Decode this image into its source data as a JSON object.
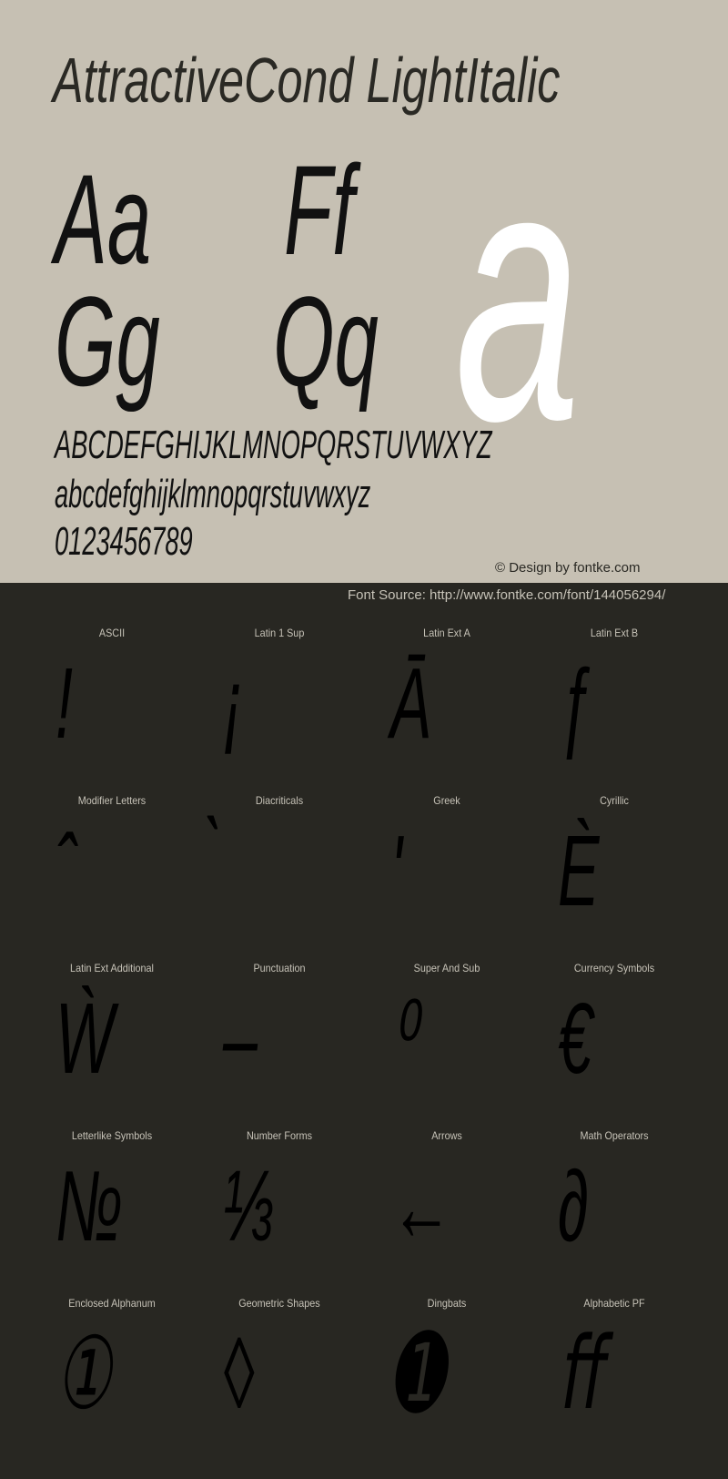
{
  "specimen": {
    "title": "AttractiveCond LightItalic",
    "pairs": [
      "Aa",
      "Ff",
      "Gg",
      "Qq"
    ],
    "hero_glyph": "a",
    "uppercase": "ABCDEFGHIJKLMNOPQRSTUVWXYZ",
    "lowercase": "abcdefghijklmnopqrstuvwxyz",
    "digits": "0123456789",
    "credit": "© Design by fontke.com",
    "source": "Font Source: http://www.fontke.com/font/144056294/"
  },
  "colors": {
    "top_background": "#c6c0b3",
    "bottom_background": "#282722",
    "hero_glyph": "#ffffff",
    "label_text": "#c7c3b8"
  },
  "blocks": [
    {
      "label": "ASCII",
      "glyph": "!"
    },
    {
      "label": "Latin 1 Sup",
      "glyph": "¡"
    },
    {
      "label": "Latin Ext A",
      "glyph": "Ā"
    },
    {
      "label": "Latin Ext B",
      "glyph": "ƒ"
    },
    {
      "label": "Modifier Letters",
      "glyph": "ˆ"
    },
    {
      "label": "Diacriticals",
      "glyph": "̀"
    },
    {
      "label": "Greek",
      "glyph": "ʹ"
    },
    {
      "label": "Cyrillic",
      "glyph": "Ѐ"
    },
    {
      "label": "Latin Ext Additional",
      "glyph": "Ẁ"
    },
    {
      "label": "Punctuation",
      "glyph": "–"
    },
    {
      "label": "Super And Sub",
      "glyph": "⁰"
    },
    {
      "label": "Currency Symbols",
      "glyph": "€"
    },
    {
      "label": "Letterlike Symbols",
      "glyph": "№"
    },
    {
      "label": "Number Forms",
      "glyph": "⅓"
    },
    {
      "label": "Arrows",
      "glyph": "←"
    },
    {
      "label": "Math Operators",
      "glyph": "∂"
    },
    {
      "label": "Enclosed Alphanum",
      "glyph": "①"
    },
    {
      "label": "Geometric Shapes",
      "glyph": "◊"
    },
    {
      "label": "Dingbats",
      "glyph": "➊"
    },
    {
      "label": "Alphabetic PF",
      "glyph": "ﬀ"
    }
  ]
}
